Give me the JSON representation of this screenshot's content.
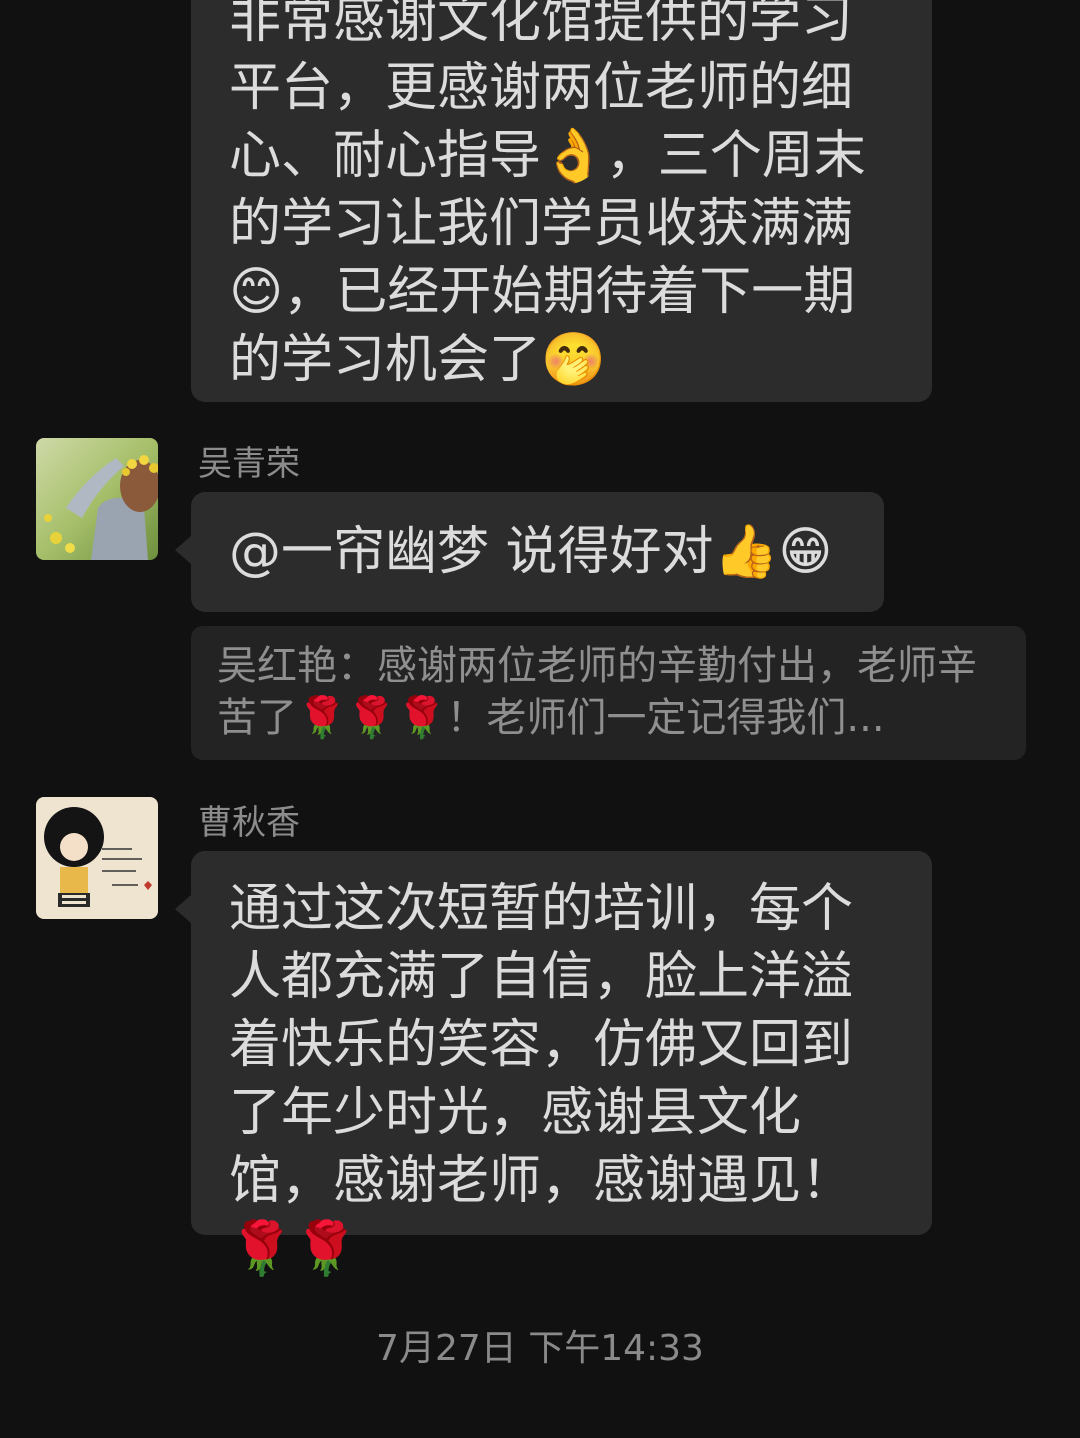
{
  "messages": [
    {
      "text": "非常感谢文化馆提供的学习平台，更感谢两位老师的细心、耐心指导👌，三个周末的学习让我们学员收获满满😊，已经开始期待着下一期的学习机会了🤭"
    },
    {
      "sender": "吴青荣",
      "text": "@一帘幽梦  说得好对👍😁"
    },
    {
      "quote": "吴红艳：感谢两位老师的辛勤付出，老师辛苦了🌹🌹🌹！老师们一定记得我们..."
    },
    {
      "sender": "曹秋香",
      "text": "通过这次短暂的培训，每个人都充满了自信，脸上洋溢着快乐的笑容，仿佛又回到了年少时光，感谢县文化馆，感谢老师，感谢遇见！🌹🌹"
    }
  ],
  "timestamp": "7月27日 下午14:33",
  "avatars": {
    "user1": "avatar-girl-with-flowers",
    "user2": "avatar-cartoon-girl"
  }
}
